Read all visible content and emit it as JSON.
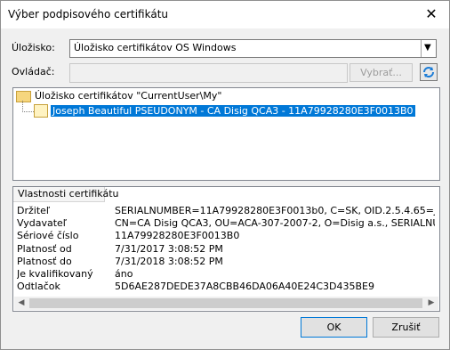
{
  "window": {
    "title": "Výber podpisového certifikátu",
    "close_glyph": "✕"
  },
  "store": {
    "label": "Úložisko:",
    "value": "Úložisko certifikátov OS Windows"
  },
  "driver": {
    "label": "Ovládač:",
    "value": "",
    "select_button": "Vybrať..."
  },
  "tree": {
    "root_label": "Úložisko certifikátov \"CurrentUser\\My\"",
    "selected_cert": "Joseph Beautiful PSEUDONYM - CA Disig QCA3 - 11A79928280E3F0013B0"
  },
  "properties": {
    "header": "Vlastnosti certifikátu",
    "rows": [
      {
        "key": "Držiteľ",
        "value": "SERIALNUMBER=11A79928280E3F0013b0, C=SK, OID.2.5.4.65=Joseph Be"
      },
      {
        "key": "Vydavateľ",
        "value": "CN=CA Disig QCA3, OU=ACA-307-2007-2, O=Disig a.s., SERIALNUMBER=N"
      },
      {
        "key": "Sériové číslo",
        "value": "11A79928280E3F0013B0"
      },
      {
        "key": "Platnosť od",
        "value": "7/31/2017 3:08:52 PM"
      },
      {
        "key": "Platnosť do",
        "value": "7/31/2018 3:08:52 PM"
      },
      {
        "key": "Je kvalifikovaný",
        "value": "áno"
      },
      {
        "key": "Odtlačok",
        "value": "5D6AE287DEDE37A8CBB46DA06A40E24C3D435BE9"
      }
    ]
  },
  "buttons": {
    "ok": "OK",
    "cancel": "Zrušiť"
  },
  "icons": {
    "close": "close-icon",
    "dropdown": "chevron-down-icon",
    "refresh": "refresh-icon",
    "folder": "folder-icon",
    "certificate": "certificate-icon"
  },
  "colors": {
    "selection": "#0078d7",
    "refresh_icon": "#1c7cd6"
  }
}
